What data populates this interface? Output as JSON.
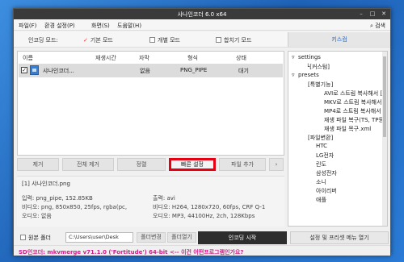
{
  "window": {
    "title": "샤나인코더 6.0 x64"
  },
  "menu": [
    "파일(F)",
    "환경 설정(P)",
    "화면(S)",
    "도움말(H)"
  ],
  "search_label": "검색",
  "modes": {
    "beginner": "인코딩 모드:",
    "basic": "기본 모드",
    "individual": "개별 모드",
    "merge": "합치기 모드",
    "kiss": "키스컴"
  },
  "list": {
    "columns": [
      "이름",
      "재생시간",
      "자막",
      "형식",
      "상태"
    ],
    "rows": [
      {
        "name": "샤나인코더...",
        "duration": "",
        "subtitle": "없음",
        "format": "PNG_PIPE",
        "status": "대기"
      }
    ]
  },
  "tree": {
    "items": [
      "settings",
      "└[커스텀]",
      "presets",
      "[특별기능]",
      "AVI로 스트림 복사해서 [",
      "MKV로 스트림 복사해서",
      "MP4로 스트림 복사해서",
      "재생 파일 복구(TS, TP등",
      "재생 파일 목구.xml",
      "[파일변환]",
      "HTC",
      "LG전자",
      "린도",
      "삼성전자",
      "소니",
      "아이리버",
      "애플"
    ]
  },
  "buttons": {
    "remove": "제거",
    "remove_all": "전체 제거",
    "sort": "정렬",
    "quick_setting": "빠른 설정",
    "add_file": "파일 추가",
    "more": "›"
  },
  "info": {
    "filename": "[1] 샤나인코더.png",
    "input": "입력: png_pipe, 152.85KB",
    "video_in": "비디오: png, 850x850, 25fps, rgba(pc,",
    "audio_in": "오디오: 없음",
    "output": "출력: avi",
    "video_out": "비디오: H264, 1280x720, 60fps, CRF Q-1",
    "audio_out": "오디오: MP3, 44100Hz, 2ch, 128Kbps"
  },
  "bottom": {
    "source_folder": "원본 폴더",
    "path": "C:\\Users\\user\\Desk",
    "folder_change": "폴더변경",
    "folder_open": "폴더열기",
    "start": "인코딩 시작",
    "preset_menu": "설정 및 프리셋 메뉴 열기"
  },
  "status": "SD인코더: mkvmerge v71.1.0 ('Fortitude') 64-bit  <-- 이건 어떤프로그램인가요?"
}
